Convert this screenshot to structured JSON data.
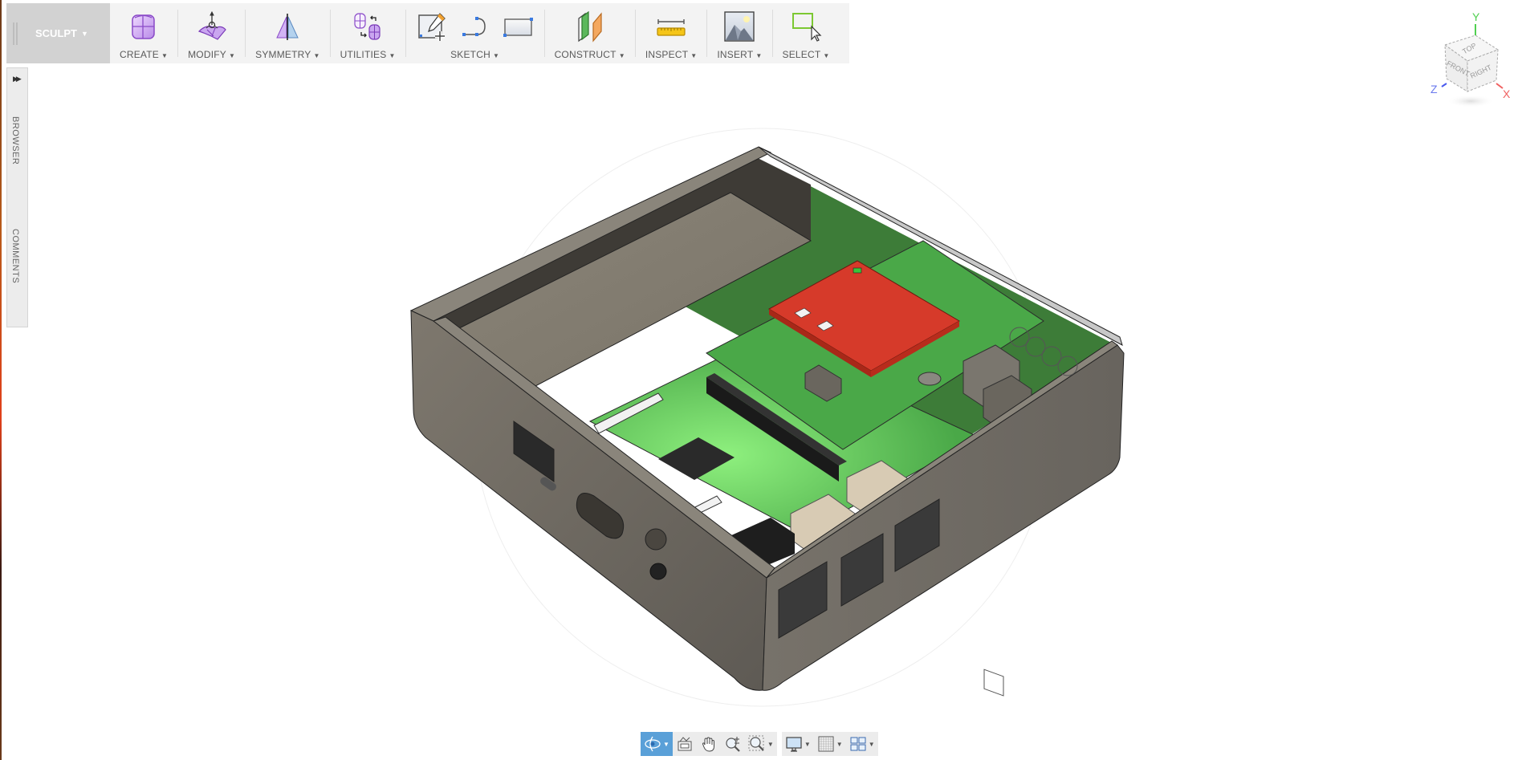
{
  "workspace": {
    "label": "SCULPT",
    "menu_indicator": "▼"
  },
  "toolbar": {
    "groups": [
      {
        "id": "create",
        "label": "CREATE",
        "icons": [
          "box-icon"
        ]
      },
      {
        "id": "modify",
        "label": "MODIFY",
        "icons": [
          "edit-form-icon"
        ]
      },
      {
        "id": "symmetry",
        "label": "SYMMETRY",
        "icons": [
          "mirror-icon"
        ]
      },
      {
        "id": "utilities",
        "label": "UTILITIES",
        "icons": [
          "convert-icon"
        ]
      },
      {
        "id": "sketch",
        "label": "SKETCH",
        "icons": [
          "create-sketch-icon",
          "spline-icon",
          "rectangle-icon"
        ]
      },
      {
        "id": "construct",
        "label": "CONSTRUCT",
        "icons": [
          "offset-plane-icon"
        ]
      },
      {
        "id": "inspect",
        "label": "INSPECT",
        "icons": [
          "measure-icon"
        ]
      },
      {
        "id": "insert",
        "label": "INSERT",
        "icons": [
          "insert-image-icon"
        ]
      },
      {
        "id": "select",
        "label": "SELECT",
        "icons": [
          "window-select-icon"
        ]
      }
    ],
    "caret": "▼"
  },
  "side_panel": {
    "expand_glyph": "▶▶",
    "tabs": [
      "BROWSER",
      "COMMENTS"
    ]
  },
  "viewcube": {
    "faces": {
      "top": "TOP",
      "front": "FRONT",
      "right": "RIGHT"
    },
    "axes": {
      "x": "X",
      "y": "Y",
      "z": "Z"
    },
    "axis_colors": {
      "x": "#f06060",
      "y": "#50d050",
      "z": "#4a5aee"
    }
  },
  "navbar": {
    "groups": [
      [
        {
          "id": "orbit",
          "icon": "orbit-icon",
          "dropdown": true,
          "active": true
        },
        {
          "id": "look-at",
          "icon": "look-at-icon",
          "dropdown": false
        },
        {
          "id": "pan",
          "icon": "pan-hand-icon",
          "dropdown": false
        },
        {
          "id": "zoom",
          "icon": "zoom-icon",
          "dropdown": false
        },
        {
          "id": "fit",
          "icon": "zoom-window-icon",
          "dropdown": true
        }
      ],
      [
        {
          "id": "display-settings",
          "icon": "display-settings-icon",
          "dropdown": true
        },
        {
          "id": "grid-snaps",
          "icon": "grid-icon",
          "dropdown": true
        },
        {
          "id": "viewports",
          "icon": "viewports-icon",
          "dropdown": true
        }
      ]
    ],
    "dropdown_glyph": "▼"
  },
  "scene": {
    "model": "Raspberry Pi enclosure with board",
    "colors": {
      "case": "#6e6a62",
      "case_light": "#8a857b",
      "case_dark": "#3a3732",
      "pcb": "#5fd45a",
      "pcb_dark": "#3d8a3a",
      "hat": "#d63a2a",
      "usb_port": "#d8cbb4",
      "chip": "#2a2a2a"
    }
  }
}
